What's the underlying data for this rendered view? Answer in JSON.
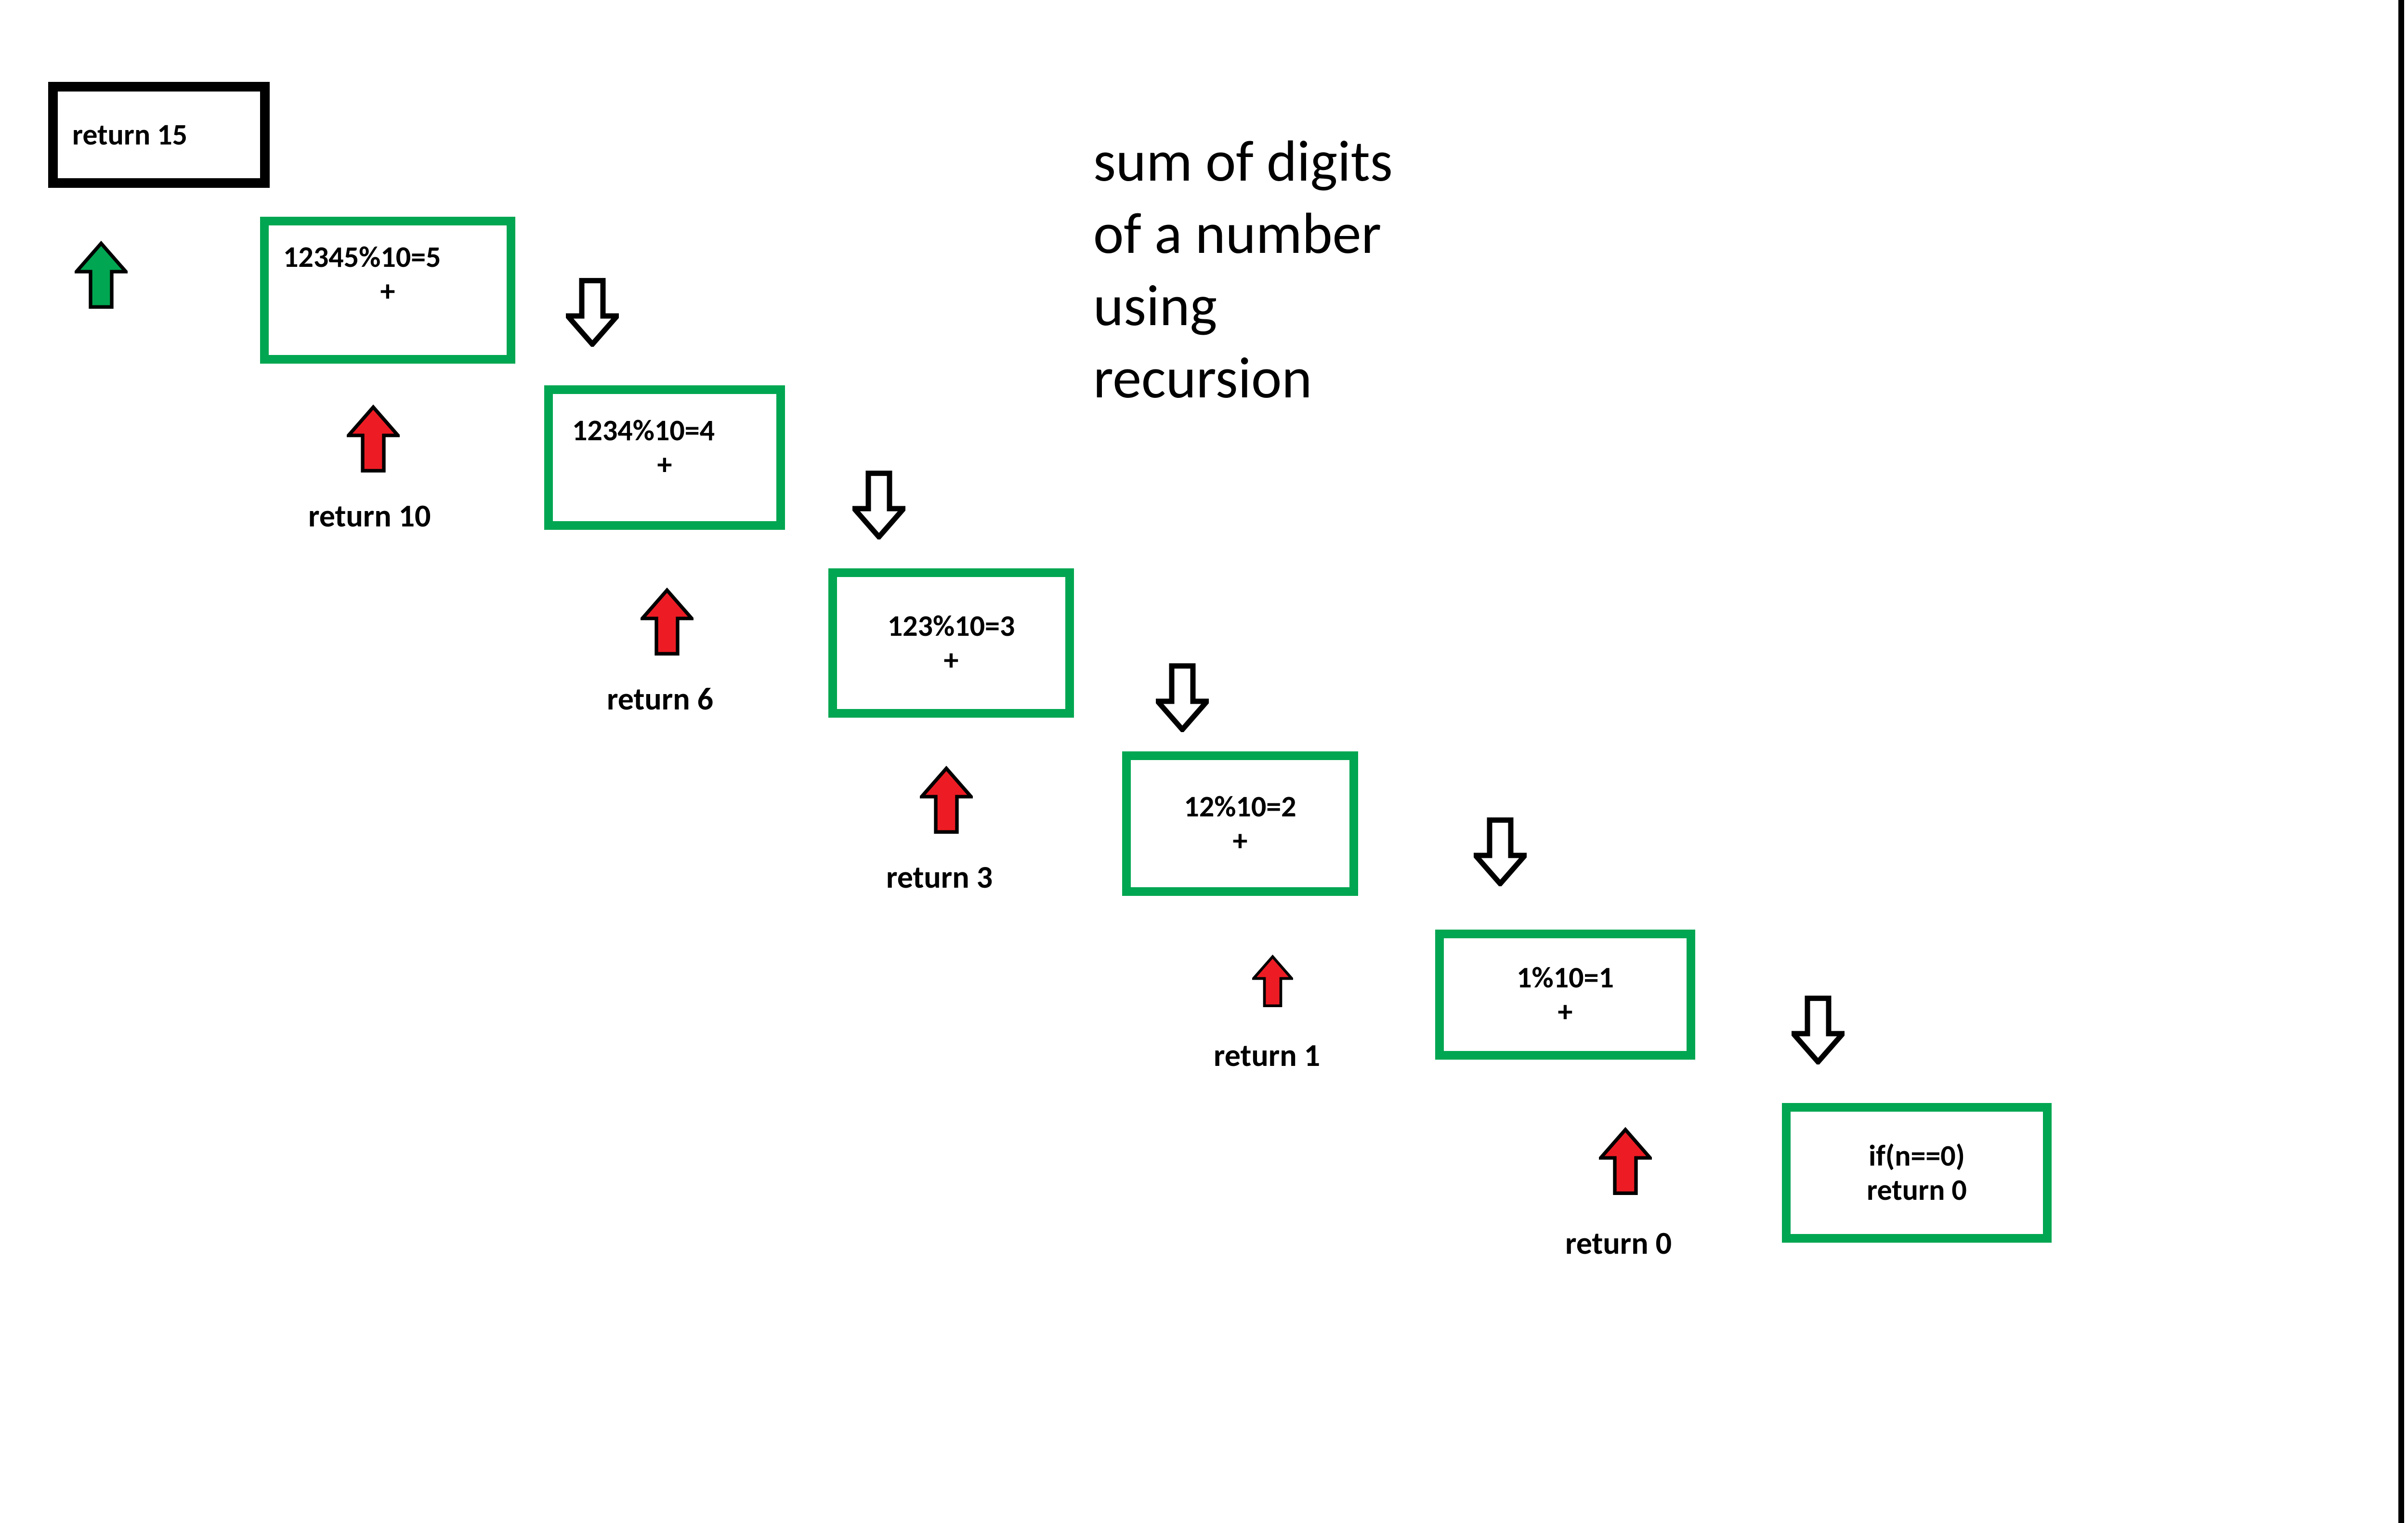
{
  "title": {
    "line1": "sum of digits",
    "line2": "of a number",
    "line3": "using",
    "line4": "recursion"
  },
  "result_box": {
    "text": "return 15"
  },
  "steps": [
    {
      "expr": "12345%10=5",
      "plus": "+",
      "ret": "return 10"
    },
    {
      "expr": "1234%10=4",
      "plus": "+",
      "ret": "return 6"
    },
    {
      "expr": "123%10=3",
      "plus": "+",
      "ret": "return 3"
    },
    {
      "expr": "12%10=2",
      "plus": "+",
      "ret": "return 1"
    },
    {
      "expr": "1%10=1",
      "plus": "+",
      "ret": "return 0"
    }
  ],
  "base_case": {
    "line1": "if(n==0)",
    "line2": "return 0"
  },
  "colors": {
    "green": "#00a651",
    "red": "#ed1c24",
    "black": "#000000"
  }
}
